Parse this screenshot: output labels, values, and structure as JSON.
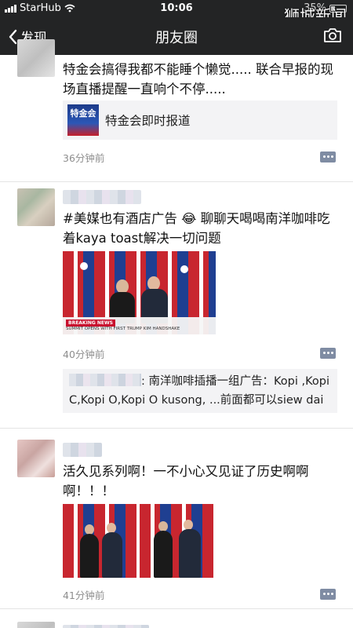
{
  "status_bar": {
    "carrier": "StarHub",
    "time": "10:06",
    "battery": "35%"
  },
  "watermark": "狮城新闻",
  "nav": {
    "back_label": "发现",
    "title": "朋友圈"
  },
  "posts": [
    {
      "text": "特金会搞得我都不能睡个懒觉.....      联合早报的现场直播提醒一直响个不停.....",
      "link": {
        "thumb_text": "特金会",
        "title": "特金会即时报道"
      },
      "time": "36分钟前"
    },
    {
      "text": "#美媒也有酒店广告 😂 聊聊天喝喝南洋咖啡吃着kaya toast解决一切问题",
      "photo_caption": {
        "tag": "BREAKING NEWS",
        "line": "SUMMIT OPENS WITH FIRST TRUMP KIM HANDSHAKE"
      },
      "time": "40分钟前",
      "reply": ": 南洋咖啡插播一组广告：Kopi ,Kopi C,Kopi O,Kopi O kusong, ...前面都可以siew dai"
    },
    {
      "text": "活久见系列啊！一不小心又见证了历史啊啊啊！！！",
      "time": "41分钟前"
    }
  ],
  "icons": [
    "signal-icon",
    "wifi-icon",
    "battery-icon",
    "back-chevron-icon",
    "camera-icon",
    "comment-icon"
  ],
  "colors": {
    "nav_bg": "#232425",
    "feed_bg": "#ffffff",
    "time_text": "#8e8e8e",
    "card_bg": "#f3f3f5"
  }
}
